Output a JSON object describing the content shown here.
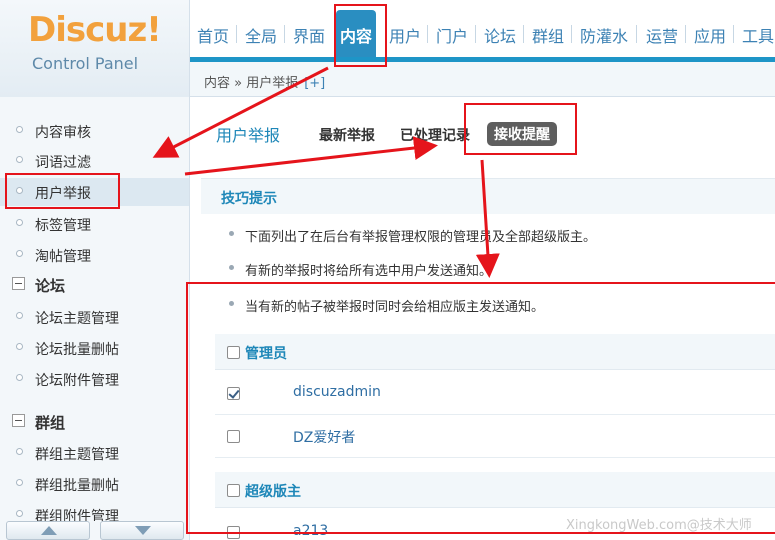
{
  "logo": {
    "main_text_d": "D",
    "main_text_rest": "iscuz",
    "main_text_bang": "!",
    "sub_text": "Control Panel"
  },
  "topnav": {
    "items": [
      {
        "label": "首页"
      },
      {
        "label": "全局"
      },
      {
        "label": "界面"
      },
      {
        "label": "内容",
        "active": true
      },
      {
        "label": "用户"
      },
      {
        "label": "门户"
      },
      {
        "label": "论坛"
      },
      {
        "label": "群组"
      },
      {
        "label": "防灌水"
      },
      {
        "label": "运营"
      },
      {
        "label": "应用"
      },
      {
        "label": "工具"
      }
    ]
  },
  "breadcrumb": {
    "text": "内容 » 用户举报",
    "plus": "[+]"
  },
  "sidebar": {
    "items": [
      {
        "label": "内容审核"
      },
      {
        "label": "词语过滤"
      },
      {
        "label": "用户举报",
        "active": true
      },
      {
        "label": "标签管理"
      },
      {
        "label": "淘帖管理"
      }
    ],
    "group_forum": {
      "label": "论坛",
      "items": [
        {
          "label": "论坛主题管理"
        },
        {
          "label": "论坛批量删帖"
        },
        {
          "label": "论坛附件管理"
        }
      ]
    },
    "group_group": {
      "label": "群组",
      "items": [
        {
          "label": "群组主题管理"
        },
        {
          "label": "群组批量删帖"
        },
        {
          "label": "群组附件管理"
        }
      ]
    }
  },
  "main": {
    "title": "用户举报",
    "tabs": [
      {
        "label": "最新举报"
      },
      {
        "label": "已处理记录"
      },
      {
        "label": "接收提醒",
        "current": true
      }
    ],
    "tips": {
      "title": "技巧提示",
      "lines": [
        "下面列出了在后台有举报管理权限的管理员及全部超级版主。",
        "有新的举报时将给所有选中用户发送通知。",
        "当有新的帖子被举报时同时会给相应版主发送通知。"
      ]
    },
    "admins": {
      "label": "管理员",
      "users": [
        {
          "name": "discuzadmin",
          "checked": true
        },
        {
          "name": "DZ爱好者",
          "checked": false
        }
      ]
    },
    "supermods": {
      "label": "超级版主",
      "users": [
        {
          "name": "a213",
          "checked": false
        }
      ]
    }
  },
  "watermark": "XingkongWeb.com@技术大师",
  "colors": {
    "accent": "#1e95c7",
    "highlight_box": "#e5141b",
    "logo_orange": "#f2a13d"
  }
}
